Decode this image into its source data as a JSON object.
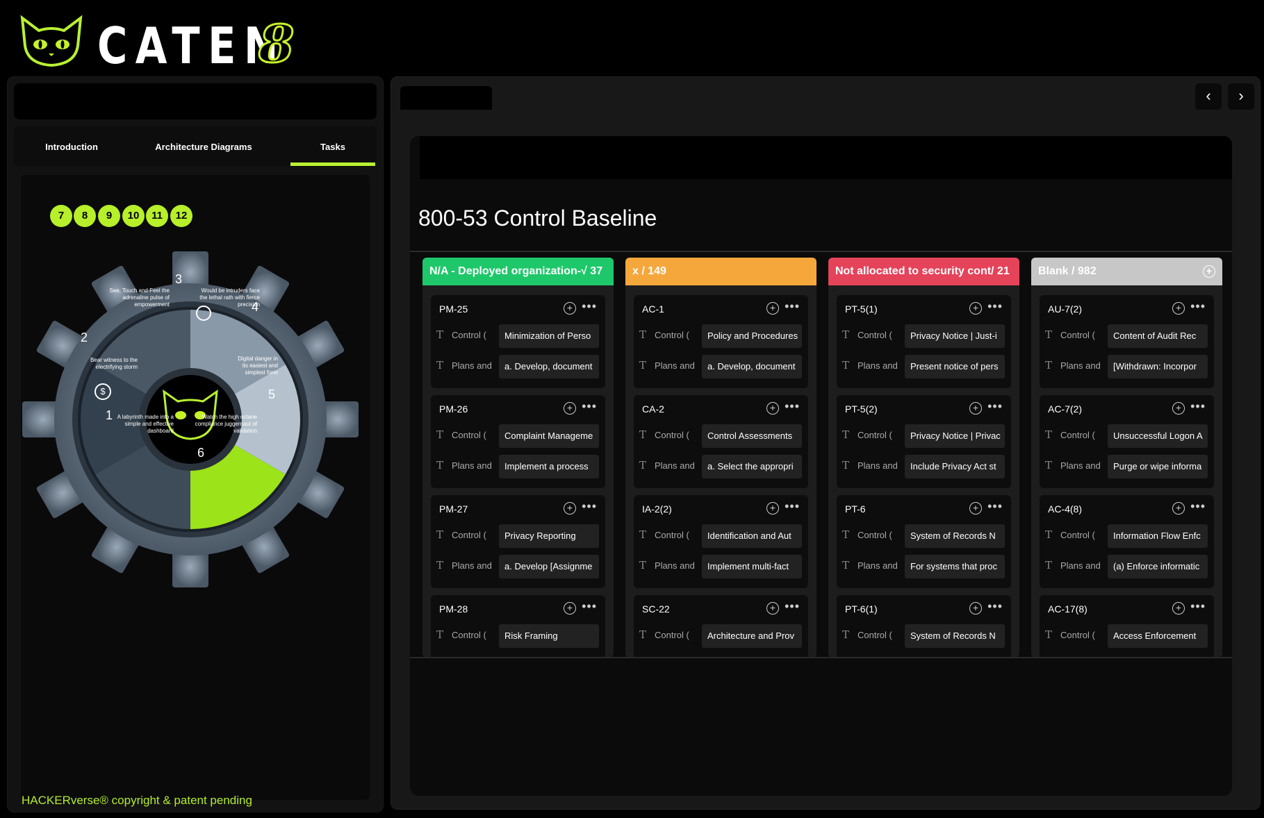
{
  "brand": {
    "name": "CATEN",
    "suffix": "8"
  },
  "left": {
    "tabs": [
      "Introduction",
      "Architecture Diagrams",
      "Tasks"
    ],
    "active_tab": "Tasks",
    "badges": [
      "7",
      "8",
      "9",
      "10",
      "11",
      "12"
    ],
    "gear": {
      "segments": [
        {
          "num": "1",
          "text": "A labyrinth made into a simple and effective dashboard"
        },
        {
          "num": "2",
          "text": "Bear witness to the electrifying storm"
        },
        {
          "num": "3",
          "text": "See, Touch and Feel the adrenaline pulse of empowerment"
        },
        {
          "num": "4",
          "text": "Would be intruders face the lethal rath with fierce precision"
        },
        {
          "num": "5",
          "text": "Digital danger in its easiest and simplest form"
        },
        {
          "num": "6",
          "text": "Watch the high octane compliance juggernaut of validation"
        }
      ]
    },
    "footer": "HACKERverse® copyright & patent pending"
  },
  "right": {
    "nav_prev": "‹",
    "nav_next": "›",
    "board_title": "800-53 Control Baseline",
    "field_labels": {
      "control": "Control (",
      "plans": "Plans and"
    },
    "columns": [
      {
        "title": "N/A - Deployed organization-√ 37",
        "color": "#1ec86a",
        "cards": [
          {
            "id": "PM-25",
            "control": "Minimization of Perso",
            "plans": "a. Develop, document"
          },
          {
            "id": "PM-26",
            "control": "Complaint Manageme",
            "plans": "Implement a process"
          },
          {
            "id": "PM-27",
            "control": "Privacy Reporting",
            "plans": "a. Develop [Assignme"
          },
          {
            "id": "PM-28",
            "control": "Risk Framing",
            "plans": ""
          }
        ]
      },
      {
        "title": "x / 149",
        "color": "#f5a73c",
        "cards": [
          {
            "id": "AC-1",
            "control": "Policy and Procedures",
            "plans": "a. Develop, document"
          },
          {
            "id": "CA-2",
            "control": "Control Assessments",
            "plans": "a. Select the appropri"
          },
          {
            "id": "IA-2(2)",
            "control": "Identification and Aut",
            "plans": "Implement multi-fact"
          },
          {
            "id": "SC-22",
            "control": "Architecture and Prov",
            "plans": ""
          }
        ]
      },
      {
        "title": "Not allocated to security cont/ 21",
        "color": "#e5435a",
        "cards": [
          {
            "id": "PT-5(1)",
            "control": "Privacy Notice | Just-i",
            "plans": "Present notice of pers"
          },
          {
            "id": "PT-5(2)",
            "control": "Privacy Notice | Privac",
            "plans": "Include Privacy Act st"
          },
          {
            "id": "PT-6",
            "control": "System of Records N",
            "plans": "For systems that proc"
          },
          {
            "id": "PT-6(1)",
            "control": "System of Records N",
            "plans": ""
          }
        ]
      },
      {
        "title": "Blank / 982",
        "color": "#c7c7c7",
        "cards": [
          {
            "id": "AU-7(2)",
            "control": "Content of Audit Rec",
            "plans": "[Withdrawn: Incorpor"
          },
          {
            "id": "AC-7(2)",
            "control": "Unsuccessful Logon A",
            "plans": "Purge or wipe informa"
          },
          {
            "id": "AC-4(8)",
            "control": "Information Flow Enfc",
            "plans": "(a) Enforce informatic"
          },
          {
            "id": "AC-17(8)",
            "control": "Access Enforcement",
            "plans": ""
          }
        ]
      }
    ]
  },
  "colors": {
    "accent": "#b7ef2a",
    "background": "#000000"
  }
}
